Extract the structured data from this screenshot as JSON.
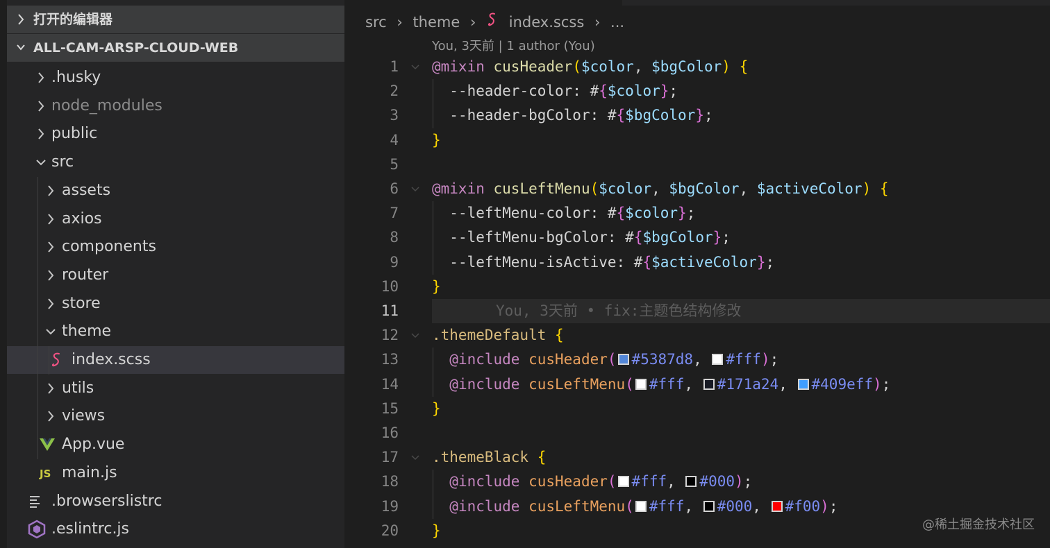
{
  "sidebar": {
    "open_editors_label": "打开的编辑器",
    "project_label": "ALL-CAM-ARSP-CLOUD-WEB",
    "tree": [
      {
        "label": ".husky",
        "kind": "folder",
        "open": false,
        "depth": 0
      },
      {
        "label": "node_modules",
        "kind": "folder",
        "open": false,
        "depth": 0,
        "dim": true
      },
      {
        "label": "public",
        "kind": "folder",
        "open": false,
        "depth": 0
      },
      {
        "label": "src",
        "kind": "folder",
        "open": true,
        "depth": 0
      },
      {
        "label": "assets",
        "kind": "folder",
        "open": false,
        "depth": 1
      },
      {
        "label": "axios",
        "kind": "folder",
        "open": false,
        "depth": 1
      },
      {
        "label": "components",
        "kind": "folder",
        "open": false,
        "depth": 1
      },
      {
        "label": "router",
        "kind": "folder",
        "open": false,
        "depth": 1
      },
      {
        "label": "store",
        "kind": "folder",
        "open": false,
        "depth": 1
      },
      {
        "label": "theme",
        "kind": "folder",
        "open": true,
        "depth": 1
      },
      {
        "label": "index.scss",
        "kind": "scss",
        "depth": 2,
        "selected": true
      },
      {
        "label": "utils",
        "kind": "folder",
        "open": false,
        "depth": 1
      },
      {
        "label": "views",
        "kind": "folder",
        "open": false,
        "depth": 1
      },
      {
        "label": "App.vue",
        "kind": "vue",
        "depth": 1
      },
      {
        "label": "main.js",
        "kind": "js",
        "depth": 1
      },
      {
        "label": ".browserslistrc",
        "kind": "lines",
        "depth": 0
      },
      {
        "label": ".eslintrc.js",
        "kind": "eslint",
        "depth": 0
      }
    ]
  },
  "breadcrumb": {
    "parts": [
      "src",
      "theme",
      "index.scss",
      "..."
    ]
  },
  "codelens": "You, 3天前 | 1 author (You)",
  "editor": {
    "current_line": 11,
    "blame": "You, 3天前 • fix:主题色结构修改",
    "lines": [
      {
        "n": "1",
        "fold": true,
        "indent": 0,
        "tokens": [
          [
            "kw",
            "@mixin "
          ],
          [
            "fn",
            "cusHeader"
          ],
          [
            "br1",
            "("
          ],
          [
            "var",
            "$color"
          ],
          [
            "plain",
            ", "
          ],
          [
            "var",
            "$bgColor"
          ],
          [
            "br1",
            ")"
          ],
          [
            "plain",
            " "
          ],
          [
            "br1",
            "{"
          ]
        ]
      },
      {
        "n": "2",
        "indent": 1,
        "tokens": [
          [
            "plain",
            "--header-color: #"
          ],
          [
            "br2",
            "{"
          ],
          [
            "var",
            "$color"
          ],
          [
            "br2",
            "}"
          ],
          [
            "plain",
            ";"
          ]
        ]
      },
      {
        "n": "3",
        "indent": 1,
        "tokens": [
          [
            "plain",
            "--header-bgColor: #"
          ],
          [
            "br2",
            "{"
          ],
          [
            "var",
            "$bgColor"
          ],
          [
            "br2",
            "}"
          ],
          [
            "plain",
            ";"
          ]
        ]
      },
      {
        "n": "4",
        "indent": 0,
        "tokens": [
          [
            "br1",
            "}"
          ]
        ]
      },
      {
        "n": "5",
        "indent": 0,
        "tokens": []
      },
      {
        "n": "6",
        "fold": true,
        "indent": 0,
        "tokens": [
          [
            "kw",
            "@mixin "
          ],
          [
            "fn",
            "cusLeftMenu"
          ],
          [
            "br1",
            "("
          ],
          [
            "var",
            "$color"
          ],
          [
            "plain",
            ", "
          ],
          [
            "var",
            "$bgColor"
          ],
          [
            "plain",
            ", "
          ],
          [
            "var",
            "$activeColor"
          ],
          [
            "br1",
            ")"
          ],
          [
            "plain",
            " "
          ],
          [
            "br1",
            "{"
          ]
        ]
      },
      {
        "n": "7",
        "indent": 1,
        "tokens": [
          [
            "plain",
            "--leftMenu-color: #"
          ],
          [
            "br2",
            "{"
          ],
          [
            "var",
            "$color"
          ],
          [
            "br2",
            "}"
          ],
          [
            "plain",
            ";"
          ]
        ]
      },
      {
        "n": "8",
        "indent": 1,
        "tokens": [
          [
            "plain",
            "--leftMenu-bgColor: #"
          ],
          [
            "br2",
            "{"
          ],
          [
            "var",
            "$bgColor"
          ],
          [
            "br2",
            "}"
          ],
          [
            "plain",
            ";"
          ]
        ]
      },
      {
        "n": "9",
        "indent": 1,
        "tokens": [
          [
            "plain",
            "--leftMenu-isActive: #"
          ],
          [
            "br2",
            "{"
          ],
          [
            "var",
            "$activeColor"
          ],
          [
            "br2",
            "}"
          ],
          [
            "plain",
            ";"
          ]
        ]
      },
      {
        "n": "10",
        "indent": 0,
        "tokens": [
          [
            "br1",
            "}"
          ]
        ]
      },
      {
        "n": "11",
        "indent": 0,
        "tokens": []
      },
      {
        "n": "12",
        "fold": true,
        "indent": 0,
        "tokens": [
          [
            "sel",
            ".themeDefault"
          ],
          [
            "plain",
            " "
          ],
          [
            "br1",
            "{"
          ]
        ]
      },
      {
        "n": "13",
        "indent": 1,
        "tokens": [
          [
            "kw",
            "@include "
          ],
          [
            "fnOrange",
            "cusHeader"
          ],
          [
            "br2",
            "("
          ],
          [
            "swatch",
            "#5387d8"
          ],
          [
            "hex",
            "#5387d8"
          ],
          [
            "plain",
            ", "
          ],
          [
            "swatch",
            "#ffffff"
          ],
          [
            "hex",
            "#fff"
          ],
          [
            "br2",
            ")"
          ],
          [
            "plain",
            ";"
          ]
        ]
      },
      {
        "n": "14",
        "indent": 1,
        "tokens": [
          [
            "kw",
            "@include "
          ],
          [
            "fnOrange",
            "cusLeftMenu"
          ],
          [
            "br2",
            "("
          ],
          [
            "swatch",
            "#ffffff"
          ],
          [
            "hex",
            "#fff"
          ],
          [
            "plain",
            ", "
          ],
          [
            "swatch",
            "#171a24"
          ],
          [
            "hex",
            "#171a24"
          ],
          [
            "plain",
            ", "
          ],
          [
            "swatch",
            "#409eff"
          ],
          [
            "hex",
            "#409eff"
          ],
          [
            "br2",
            ")"
          ],
          [
            "plain",
            ";"
          ]
        ]
      },
      {
        "n": "15",
        "indent": 0,
        "tokens": [
          [
            "br1",
            "}"
          ]
        ]
      },
      {
        "n": "16",
        "indent": 0,
        "tokens": []
      },
      {
        "n": "17",
        "fold": true,
        "indent": 0,
        "tokens": [
          [
            "sel",
            ".themeBlack"
          ],
          [
            "plain",
            " "
          ],
          [
            "br1",
            "{"
          ]
        ]
      },
      {
        "n": "18",
        "indent": 1,
        "tokens": [
          [
            "kw",
            "@include "
          ],
          [
            "fnOrange",
            "cusHeader"
          ],
          [
            "br2",
            "("
          ],
          [
            "swatch",
            "#ffffff"
          ],
          [
            "hex",
            "#fff"
          ],
          [
            "plain",
            ", "
          ],
          [
            "swatch",
            "#000000"
          ],
          [
            "hex",
            "#000"
          ],
          [
            "br2",
            ")"
          ],
          [
            "plain",
            ";"
          ]
        ]
      },
      {
        "n": "19",
        "indent": 1,
        "tokens": [
          [
            "kw",
            "@include "
          ],
          [
            "fnOrange",
            "cusLeftMenu"
          ],
          [
            "br2",
            "("
          ],
          [
            "swatch",
            "#ffffff"
          ],
          [
            "hex",
            "#fff"
          ],
          [
            "plain",
            ", "
          ],
          [
            "swatch",
            "#000000"
          ],
          [
            "hex",
            "#000"
          ],
          [
            "plain",
            ", "
          ],
          [
            "swatch",
            "#ff0000"
          ],
          [
            "hex",
            "#f00"
          ],
          [
            "br2",
            ")"
          ],
          [
            "plain",
            ";"
          ]
        ]
      },
      {
        "n": "20",
        "indent": 0,
        "tokens": [
          [
            "br1",
            "}"
          ]
        ]
      }
    ]
  },
  "watermark": "@稀土掘金技术社区",
  "colors": {
    "sidebar_bg": "#252526",
    "editor_bg": "#1e1e1e",
    "selection_bg": "#37373d",
    "scss_icon": "#f55385",
    "vue_icon": "#8dc149",
    "js_icon": "#cbcb41",
    "eslint_icon": "#a074c4"
  },
  "icons": [
    "chevron-right-icon",
    "chevron-down-icon",
    "scss-file-icon",
    "vue-file-icon",
    "js-file-icon",
    "lines-file-icon",
    "eslint-file-icon"
  ]
}
